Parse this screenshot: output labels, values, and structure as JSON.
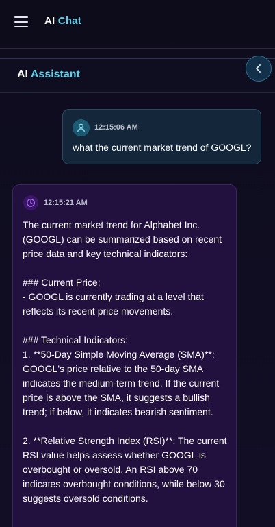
{
  "header": {
    "title_part1": "AI",
    "title_part2": "Chat"
  },
  "panel": {
    "title_part1": "AI",
    "title_part2": "Assistant"
  },
  "icons": {
    "menu": "hamburger-menu-icon",
    "collapse": "chevron-left-icon",
    "user_avatar": "user-icon",
    "ai_avatar": "clock-icon"
  },
  "colors": {
    "accent": "#5fd0e8",
    "user_bubble": "#14263a",
    "ai_bubble": "#22103f"
  },
  "messages": [
    {
      "role": "user",
      "time": "12:15:06 AM",
      "text": "what the current market trend of GOOGL?"
    },
    {
      "role": "assistant",
      "time": "12:15:21 AM",
      "paragraphs": [
        [
          "The current market trend for Alphabet Inc. (GOOGL) can be summarized based on recent price data and key technical indicators:"
        ],
        [
          "### Current Price:",
          "- GOOGL is currently trading at a level that reflects its recent price movements."
        ],
        [
          "### Technical Indicators:",
          "1. **50-Day Simple Moving Average (SMA)**: GOOGL's price relative to the 50-day SMA indicates the medium-term trend. If the current price is above the SMA, it suggests a bullish trend; if below, it indicates bearish sentiment."
        ],
        [
          "2. **Relative Strength Index (RSI)**: The current RSI value helps assess whether GOOGL is overbought or oversold. An RSI above 70 indicates overbought conditions, while below 30 suggests oversold conditions."
        ]
      ]
    }
  ]
}
